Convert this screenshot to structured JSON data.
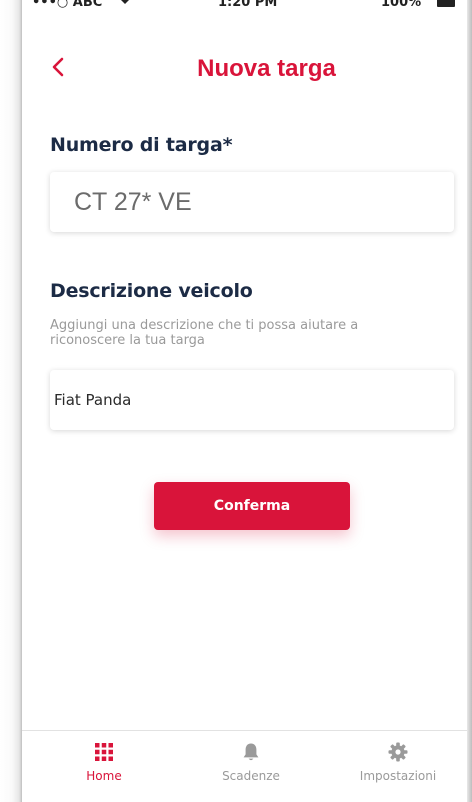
{
  "status_bar": {
    "carrier": "•••○ ABC",
    "time": "1:20 PM",
    "battery": "100%"
  },
  "header": {
    "title": "Nuova targa"
  },
  "plate_section": {
    "label": "Numero di targa*",
    "value": "CT 27* VE"
  },
  "description_section": {
    "label": "Descrizione veicolo",
    "helper": "Aggiungi una descrizione che ti possa aiutare a riconoscere la tua targa",
    "value": "Fiat Panda"
  },
  "confirm": {
    "label": "Conferma"
  },
  "tab_bar": {
    "items": [
      {
        "label": "Home",
        "icon": "grid-icon",
        "active": true
      },
      {
        "label": "Scadenze",
        "icon": "bell-icon",
        "active": false
      },
      {
        "label": "Impostazioni",
        "icon": "gear-icon",
        "active": false
      }
    ]
  },
  "colors": {
    "accent": "#d9143a",
    "heading": "#1c2b45",
    "muted": "#9a9a9a"
  }
}
